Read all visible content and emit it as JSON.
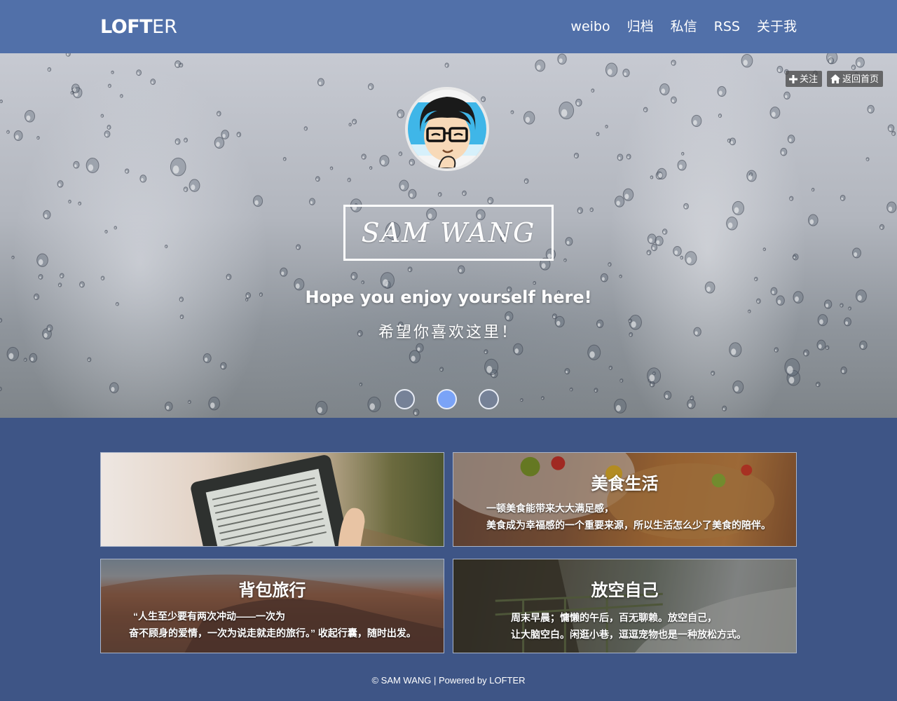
{
  "header": {
    "logo_bold": "LOFT",
    "logo_thin": "ER",
    "nav": [
      "weibo",
      "归档",
      "私信",
      "RSS",
      "关于我"
    ]
  },
  "hero": {
    "follow_label": "关注",
    "home_label": "返回首页",
    "name": "SAM WANG",
    "tagline": "Hope you enjoy yourself here!",
    "tagline_cn": "希望你喜欢这里！",
    "slides": 3,
    "active_slide": 2
  },
  "cards": [
    {
      "title": "",
      "lines": []
    },
    {
      "title": "美食生活",
      "lines": [
        "一顿美食能带来大大满足感，",
        "美食成为幸福感的一个重要来源，所以生活怎么少了美食的陪伴。"
      ]
    },
    {
      "title": "背包旅行",
      "lines": [
        "“人生至少要有两次冲动——一次为",
        "奋不顾身的爱情，一次为说走就走的旅行。” 收起行囊，随时出发。"
      ]
    },
    {
      "title": "放空自己",
      "lines": [
        "周末早晨；慵懒的午后，百无聊赖。放空自己，",
        "让大脑空白。闲逛小巷，逗逗宠物也是一种放松方式。"
      ]
    }
  ],
  "footer": {
    "text": "© SAM WANG | Powered by LOFTER"
  },
  "colors": {
    "nav_bg": "#5170a9",
    "page_bg": "#3e5586",
    "dot_active": "#7aa3f7"
  }
}
